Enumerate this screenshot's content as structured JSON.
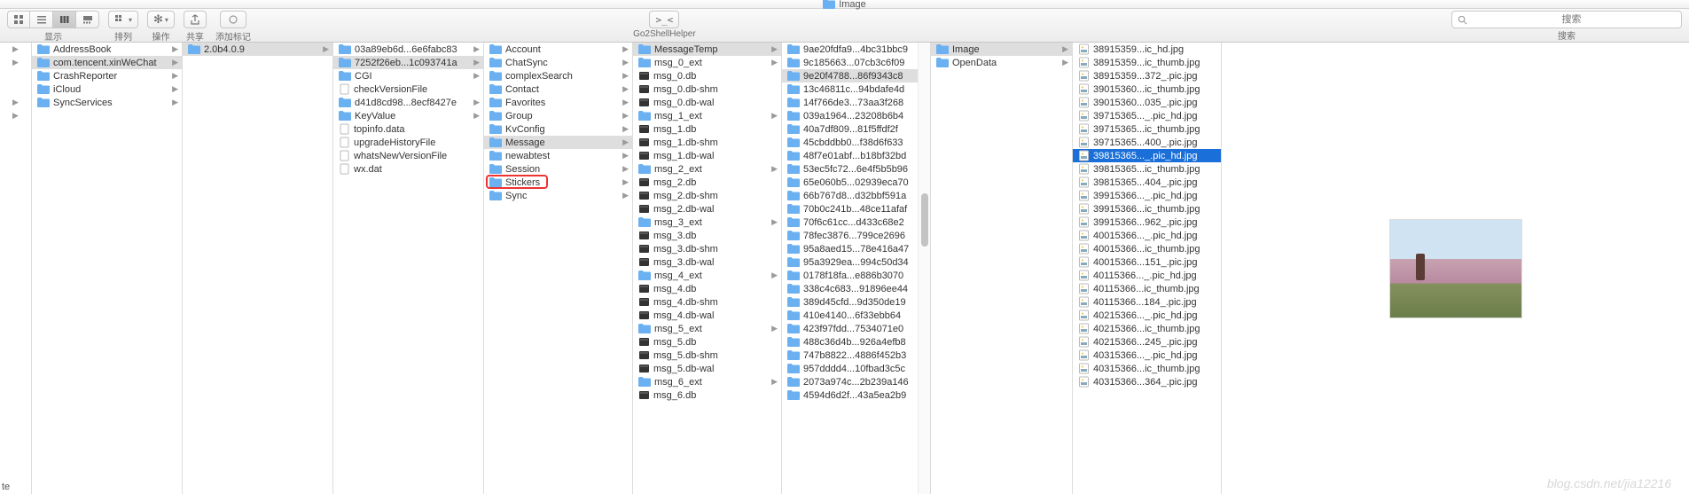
{
  "titlebar": {
    "folder_label": "Image"
  },
  "toolbar": {
    "view_label": "显示",
    "arrange_label": "排列",
    "action_label": "操作",
    "share_label": "共享",
    "tags_label": "添加标记",
    "helper_label": "Go2ShellHelper",
    "search_label": "搜索",
    "search_placeholder": "搜索"
  },
  "col_pre": {
    "rows": [
      ">",
      ">",
      "",
      "",
      ">",
      ">"
    ],
    "bottom": "te"
  },
  "col0": {
    "items": [
      {
        "name": "AddressBook",
        "type": "folder",
        "arrow": true,
        "sel": ""
      },
      {
        "name": "com.tencent.xinWeChat",
        "type": "folder",
        "arrow": true,
        "sel": "gray"
      },
      {
        "name": "CrashReporter",
        "type": "folder",
        "arrow": true,
        "sel": ""
      },
      {
        "name": "iCloud",
        "type": "folder",
        "arrow": true,
        "sel": ""
      },
      {
        "name": "SyncServices",
        "type": "folder",
        "arrow": true,
        "sel": ""
      }
    ]
  },
  "col1": {
    "items": [
      {
        "name": "2.0b4.0.9",
        "type": "folder",
        "arrow": true,
        "sel": "gray"
      }
    ]
  },
  "col2": {
    "items": [
      {
        "name": "03a89eb6d...6e6fabc83",
        "type": "folder",
        "arrow": true,
        "sel": ""
      },
      {
        "name": "7252f26eb...1c093741a",
        "type": "folder",
        "arrow": true,
        "sel": "gray"
      },
      {
        "name": "CGI",
        "type": "folder",
        "arrow": true,
        "sel": ""
      },
      {
        "name": "checkVersionFile",
        "type": "file",
        "arrow": false,
        "sel": ""
      },
      {
        "name": "d41d8cd98...8ecf8427e",
        "type": "folder",
        "arrow": true,
        "sel": ""
      },
      {
        "name": "KeyValue",
        "type": "folder",
        "arrow": true,
        "sel": ""
      },
      {
        "name": "topinfo.data",
        "type": "file",
        "arrow": false,
        "sel": ""
      },
      {
        "name": "upgradeHistoryFile",
        "type": "file",
        "arrow": false,
        "sel": ""
      },
      {
        "name": "whatsNewVersionFile",
        "type": "file",
        "arrow": false,
        "sel": ""
      },
      {
        "name": "wx.dat",
        "type": "file",
        "arrow": false,
        "sel": ""
      }
    ]
  },
  "col3": {
    "items": [
      {
        "name": "Account",
        "type": "folder",
        "arrow": true,
        "sel": ""
      },
      {
        "name": "ChatSync",
        "type": "folder",
        "arrow": true,
        "sel": ""
      },
      {
        "name": "complexSearch",
        "type": "folder",
        "arrow": true,
        "sel": ""
      },
      {
        "name": "Contact",
        "type": "folder",
        "arrow": true,
        "sel": ""
      },
      {
        "name": "Favorites",
        "type": "folder",
        "arrow": true,
        "sel": ""
      },
      {
        "name": "Group",
        "type": "folder",
        "arrow": true,
        "sel": ""
      },
      {
        "name": "KvConfig",
        "type": "folder",
        "arrow": true,
        "sel": ""
      },
      {
        "name": "Message",
        "type": "folder",
        "arrow": true,
        "sel": "gray"
      },
      {
        "name": "newabtest",
        "type": "folder",
        "arrow": true,
        "sel": ""
      },
      {
        "name": "Session",
        "type": "folder",
        "arrow": true,
        "sel": ""
      },
      {
        "name": "Stickers",
        "type": "folder",
        "arrow": true,
        "sel": ""
      },
      {
        "name": "Sync",
        "type": "folder",
        "arrow": true,
        "sel": ""
      }
    ],
    "redbox_index": 10
  },
  "col4": {
    "items": [
      {
        "name": "MessageTemp",
        "type": "folder",
        "arrow": true,
        "sel": "gray"
      },
      {
        "name": "msg_0_ext",
        "type": "folder",
        "arrow": true,
        "sel": ""
      },
      {
        "name": "msg_0.db",
        "type": "exec",
        "arrow": false,
        "sel": ""
      },
      {
        "name": "msg_0.db-shm",
        "type": "exec",
        "arrow": false,
        "sel": ""
      },
      {
        "name": "msg_0.db-wal",
        "type": "exec",
        "arrow": false,
        "sel": ""
      },
      {
        "name": "msg_1_ext",
        "type": "folder",
        "arrow": true,
        "sel": ""
      },
      {
        "name": "msg_1.db",
        "type": "exec",
        "arrow": false,
        "sel": ""
      },
      {
        "name": "msg_1.db-shm",
        "type": "exec",
        "arrow": false,
        "sel": ""
      },
      {
        "name": "msg_1.db-wal",
        "type": "exec",
        "arrow": false,
        "sel": ""
      },
      {
        "name": "msg_2_ext",
        "type": "folder",
        "arrow": true,
        "sel": ""
      },
      {
        "name": "msg_2.db",
        "type": "exec",
        "arrow": false,
        "sel": ""
      },
      {
        "name": "msg_2.db-shm",
        "type": "exec",
        "arrow": false,
        "sel": ""
      },
      {
        "name": "msg_2.db-wal",
        "type": "exec",
        "arrow": false,
        "sel": ""
      },
      {
        "name": "msg_3_ext",
        "type": "folder",
        "arrow": true,
        "sel": ""
      },
      {
        "name": "msg_3.db",
        "type": "exec",
        "arrow": false,
        "sel": ""
      },
      {
        "name": "msg_3.db-shm",
        "type": "exec",
        "arrow": false,
        "sel": ""
      },
      {
        "name": "msg_3.db-wal",
        "type": "exec",
        "arrow": false,
        "sel": ""
      },
      {
        "name": "msg_4_ext",
        "type": "folder",
        "arrow": true,
        "sel": ""
      },
      {
        "name": "msg_4.db",
        "type": "exec",
        "arrow": false,
        "sel": ""
      },
      {
        "name": "msg_4.db-shm",
        "type": "exec",
        "arrow": false,
        "sel": ""
      },
      {
        "name": "msg_4.db-wal",
        "type": "exec",
        "arrow": false,
        "sel": ""
      },
      {
        "name": "msg_5_ext",
        "type": "folder",
        "arrow": true,
        "sel": ""
      },
      {
        "name": "msg_5.db",
        "type": "exec",
        "arrow": false,
        "sel": ""
      },
      {
        "name": "msg_5.db-shm",
        "type": "exec",
        "arrow": false,
        "sel": ""
      },
      {
        "name": "msg_5.db-wal",
        "type": "exec",
        "arrow": false,
        "sel": ""
      },
      {
        "name": "msg_6_ext",
        "type": "folder",
        "arrow": true,
        "sel": ""
      },
      {
        "name": "msg_6.db",
        "type": "exec",
        "arrow": false,
        "sel": ""
      }
    ]
  },
  "col5": {
    "items": [
      {
        "name": "9ae20fdfa9...4bc31bbc9",
        "type": "folder",
        "arrow": true,
        "sel": ""
      },
      {
        "name": "9c185663...07cb3c6f09",
        "type": "folder",
        "arrow": true,
        "sel": ""
      },
      {
        "name": "9e20f4788...86f9343c8",
        "type": "folder",
        "arrow": true,
        "sel": "gray"
      },
      {
        "name": "13c46811c...94bdafe4d",
        "type": "folder",
        "arrow": true,
        "sel": ""
      },
      {
        "name": "14f766de3...73aa3f268",
        "type": "folder",
        "arrow": true,
        "sel": ""
      },
      {
        "name": "039a1964...23208b6b4",
        "type": "folder",
        "arrow": true,
        "sel": ""
      },
      {
        "name": "40a7df809...81f5ffdf2f",
        "type": "folder",
        "arrow": true,
        "sel": ""
      },
      {
        "name": "45cbddbb0...f38d6f633",
        "type": "folder",
        "arrow": true,
        "sel": ""
      },
      {
        "name": "48f7e01abf...b18bf32bd",
        "type": "folder",
        "arrow": true,
        "sel": ""
      },
      {
        "name": "53ec5fc72...6e4f5b5b96",
        "type": "folder",
        "arrow": true,
        "sel": ""
      },
      {
        "name": "65e060b5...02939eca70",
        "type": "folder",
        "arrow": true,
        "sel": ""
      },
      {
        "name": "66b767d8...d32bbf591a",
        "type": "folder",
        "arrow": true,
        "sel": ""
      },
      {
        "name": "70b0c241b...48ce11afaf",
        "type": "folder",
        "arrow": true,
        "sel": ""
      },
      {
        "name": "70f6c61cc...d433c68e2",
        "type": "folder",
        "arrow": true,
        "sel": ""
      },
      {
        "name": "78fec3876...799ce2696",
        "type": "folder",
        "arrow": true,
        "sel": ""
      },
      {
        "name": "95a8aed15...78e416a47",
        "type": "folder",
        "arrow": true,
        "sel": ""
      },
      {
        "name": "95a3929ea...994c50d34",
        "type": "folder",
        "arrow": true,
        "sel": ""
      },
      {
        "name": "0178f18fa...e886b3070",
        "type": "folder",
        "arrow": true,
        "sel": ""
      },
      {
        "name": "338c4c683...91896ee44",
        "type": "folder",
        "arrow": true,
        "sel": ""
      },
      {
        "name": "389d45cfd...9d350de19",
        "type": "folder",
        "arrow": true,
        "sel": ""
      },
      {
        "name": "410e4140...6f33ebb64",
        "type": "folder",
        "arrow": true,
        "sel": ""
      },
      {
        "name": "423f97fdd...7534071e0",
        "type": "folder",
        "arrow": true,
        "sel": ""
      },
      {
        "name": "488c36d4b...926a4efb8",
        "type": "folder",
        "arrow": true,
        "sel": ""
      },
      {
        "name": "747b8822...4886f452b3",
        "type": "folder",
        "arrow": true,
        "sel": ""
      },
      {
        "name": "957dddd4...10fbad3c5c",
        "type": "folder",
        "arrow": true,
        "sel": ""
      },
      {
        "name": "2073a974c...2b239a146",
        "type": "folder",
        "arrow": true,
        "sel": ""
      },
      {
        "name": "4594d6d2f...43a5ea2b9",
        "type": "folder",
        "arrow": true,
        "sel": ""
      }
    ]
  },
  "col6": {
    "items": [
      {
        "name": "Image",
        "type": "folder",
        "arrow": true,
        "sel": "gray"
      },
      {
        "name": "OpenData",
        "type": "folder",
        "arrow": true,
        "sel": ""
      }
    ]
  },
  "col7": {
    "items": [
      {
        "name": "38915359...ic_hd.jpg",
        "type": "jpg",
        "arrow": false,
        "sel": ""
      },
      {
        "name": "38915359...ic_thumb.jpg",
        "type": "jpg",
        "arrow": false,
        "sel": ""
      },
      {
        "name": "38915359...372_.pic.jpg",
        "type": "jpg",
        "arrow": false,
        "sel": ""
      },
      {
        "name": "39015360...ic_thumb.jpg",
        "type": "jpg",
        "arrow": false,
        "sel": ""
      },
      {
        "name": "39015360...035_.pic.jpg",
        "type": "jpg",
        "arrow": false,
        "sel": ""
      },
      {
        "name": "39715365..._.pic_hd.jpg",
        "type": "jpg",
        "arrow": false,
        "sel": ""
      },
      {
        "name": "39715365...ic_thumb.jpg",
        "type": "jpg",
        "arrow": false,
        "sel": ""
      },
      {
        "name": "39715365...400_.pic.jpg",
        "type": "jpg",
        "arrow": false,
        "sel": ""
      },
      {
        "name": "39815365..._.pic_hd.jpg",
        "type": "jpg",
        "arrow": false,
        "sel": "blue"
      },
      {
        "name": "39815365...ic_thumb.jpg",
        "type": "jpg",
        "arrow": false,
        "sel": ""
      },
      {
        "name": "39815365...404_.pic.jpg",
        "type": "jpg",
        "arrow": false,
        "sel": ""
      },
      {
        "name": "39915366..._.pic_hd.jpg",
        "type": "jpg",
        "arrow": false,
        "sel": ""
      },
      {
        "name": "39915366...ic_thumb.jpg",
        "type": "jpg",
        "arrow": false,
        "sel": ""
      },
      {
        "name": "39915366...962_.pic.jpg",
        "type": "jpg",
        "arrow": false,
        "sel": ""
      },
      {
        "name": "40015366..._.pic_hd.jpg",
        "type": "jpg",
        "arrow": false,
        "sel": ""
      },
      {
        "name": "40015366...ic_thumb.jpg",
        "type": "jpg",
        "arrow": false,
        "sel": ""
      },
      {
        "name": "40015366...151_.pic.jpg",
        "type": "jpg",
        "arrow": false,
        "sel": ""
      },
      {
        "name": "40115366..._.pic_hd.jpg",
        "type": "jpg",
        "arrow": false,
        "sel": ""
      },
      {
        "name": "40115366...ic_thumb.jpg",
        "type": "jpg",
        "arrow": false,
        "sel": ""
      },
      {
        "name": "40115366...184_.pic.jpg",
        "type": "jpg",
        "arrow": false,
        "sel": ""
      },
      {
        "name": "40215366..._.pic_hd.jpg",
        "type": "jpg",
        "arrow": false,
        "sel": ""
      },
      {
        "name": "40215366...ic_thumb.jpg",
        "type": "jpg",
        "arrow": false,
        "sel": ""
      },
      {
        "name": "40215366...245_.pic.jpg",
        "type": "jpg",
        "arrow": false,
        "sel": ""
      },
      {
        "name": "40315366..._.pic_hd.jpg",
        "type": "jpg",
        "arrow": false,
        "sel": ""
      },
      {
        "name": "40315366...ic_thumb.jpg",
        "type": "jpg",
        "arrow": false,
        "sel": ""
      },
      {
        "name": "40315366...364_.pic.jpg",
        "type": "jpg",
        "arrow": false,
        "sel": ""
      }
    ]
  },
  "watermark": "blog.csdn.net/jia12216"
}
